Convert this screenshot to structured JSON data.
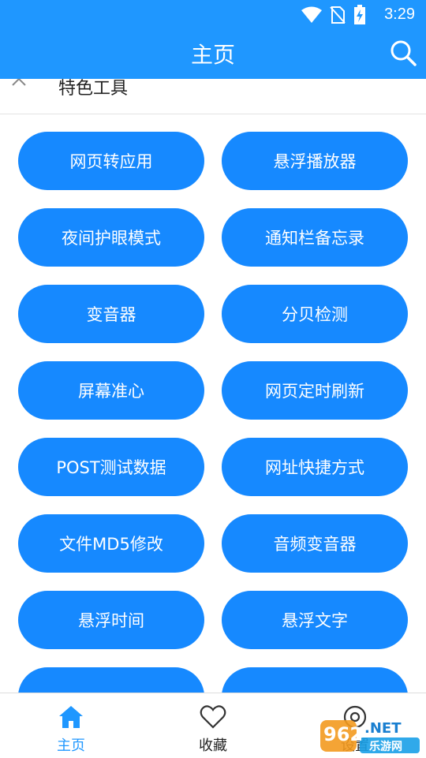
{
  "status_bar": {
    "time": "3:29"
  },
  "app_bar": {
    "title": "主页"
  },
  "section": {
    "title": "特色工具"
  },
  "tools": [
    "网页转应用",
    "悬浮播放器",
    "夜间护眼模式",
    "通知栏备忘录",
    "变音器",
    "分贝检测",
    "屏幕准心",
    "网页定时刷新",
    "POST测试数据",
    "网址快捷方式",
    "文件MD5修改",
    "音频变音器",
    "悬浮时间",
    "悬浮文字"
  ],
  "bottom_nav": {
    "home": "主页",
    "favorites": "收藏",
    "settings": "设置"
  },
  "watermark": {
    "num": "962",
    "net": ".NET",
    "sub": "乐游网"
  },
  "colors": {
    "primary": "#1f97ff",
    "button": "#1689ff"
  }
}
